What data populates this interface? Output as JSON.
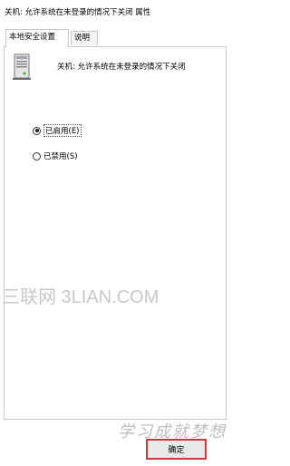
{
  "window": {
    "title": "关机: 允许系统在未登录的情况下关闭 属性"
  },
  "tabs": [
    {
      "label": "本地安全设置",
      "active": true
    },
    {
      "label": "说明",
      "active": false
    }
  ],
  "policy": {
    "icon": "server-policy-icon",
    "name": "关机: 允许系统在未登录的情况下关闭"
  },
  "options": [
    {
      "label": "已启用(E)",
      "checked": true
    },
    {
      "label": "已禁用(S)",
      "checked": false
    }
  ],
  "watermarks": {
    "site": "三联网 3LIAN.COM",
    "handwriting": "学习成就梦想"
  },
  "buttons": {
    "ok_label": "确定"
  },
  "colors": {
    "highlight_border": "#cc3b3b"
  }
}
